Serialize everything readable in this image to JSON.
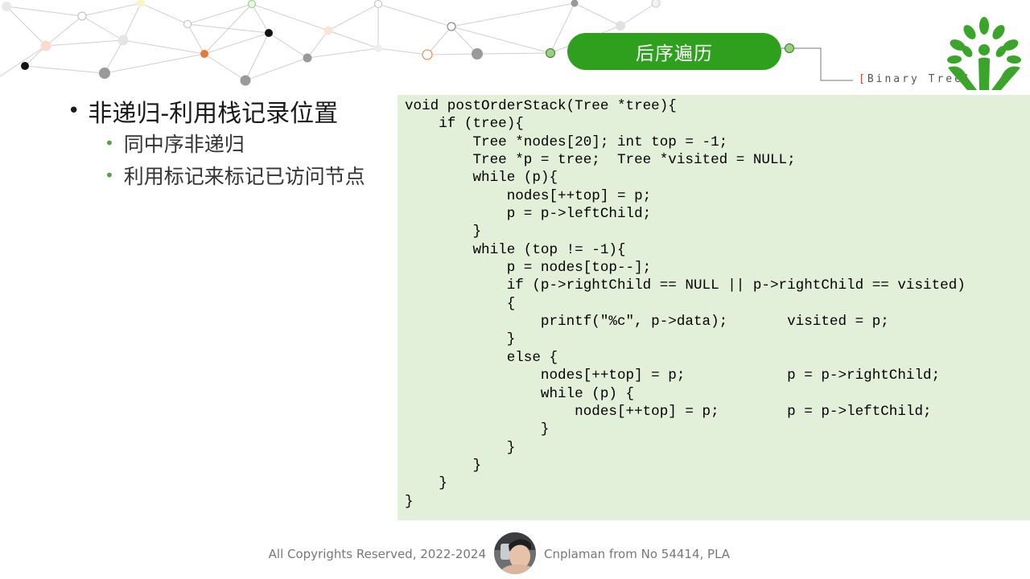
{
  "header": {
    "title": "后序遍历",
    "brand_open": "[",
    "brand_text": "Binary Tree",
    "brand_close": "]",
    "accent_color": "#2ea01e"
  },
  "bullets": {
    "main": "非递归-利用栈记录位置",
    "subs": [
      "同中序非递归",
      "利用标记来标记已访问节点"
    ]
  },
  "code_block": "void postOrderStack(Tree *tree){\n    if (tree){\n        Tree *nodes[20]; int top = -1;\n        Tree *p = tree;  Tree *visited = NULL;\n        while (p){\n            nodes[++top] = p;\n            p = p->leftChild;\n        }\n        while (top != -1){\n            p = nodes[top--];\n            if (p->rightChild == NULL || p->rightChild == visited)\n            {\n                printf(\"%c\", p->data);       visited = p;\n            }\n            else {\n                nodes[++top] = p;            p = p->rightChild;\n                while (p) {\n                    nodes[++top] = p;        p = p->leftChild;\n                }\n            }\n        }\n    }\n}",
  "footer": {
    "copyright": "All Copyrights Reserved, 2022-2024",
    "author": "Cnplaman from No 54414, PLA"
  }
}
